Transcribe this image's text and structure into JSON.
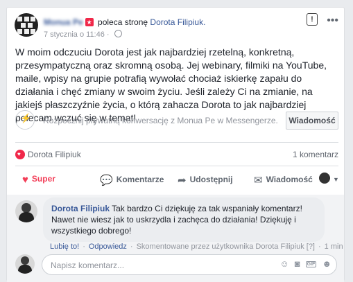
{
  "post": {
    "author": "Monua Pe",
    "recommends_text": "poleca stronę",
    "page_name": "Dorota Filipiuk.",
    "date": "7 stycznia o 11:46",
    "dot": "·",
    "body": "W moim odczuciu Dorota jest jak najbardziej rzetelną, konkretną, przesympatyczną oraz skromną osobą. Jej webinary, filmiki na YouTube, maile, wpisy na grupie potrafią wywołać chociaż iskierkę zapału do działania i chęć zmiany w swoim życiu. Jeśli zależy Ci na zmianie, na jakiejś płaszczyźnie życia, o którą zahacza Dorota to jak najbardziej polecam wczuć się w temat!",
    "icons": [
      "alert-icon",
      "more-dots-icon",
      "globe-icon"
    ]
  },
  "messenger": {
    "prompt": "Rozpocznij prywatną konwersację z Monua Pe w Messengerze.",
    "button": "Wiadomość"
  },
  "reactions": {
    "name": "Dorota Filipiuk",
    "comment_count": "1 komentarz"
  },
  "actions": {
    "super": "Super",
    "comment": "Komentarze",
    "share": "Udostępnij",
    "message": "Wiadomość"
  },
  "comment": {
    "author": "Dorota Filipiuk",
    "text": "Tak bardzo Ci dziękuję za tak wspaniały komentarz! Nawet nie wiesz jak to uskrzydla i zachęca do działania! Dziękuję i wszystkiego dobrego!",
    "like": "Lubię to!",
    "reply": "Odpowiedz",
    "commented_by": "Skomentowane przez użytkownika Dorota Filipiuk [?]",
    "time": "1 min"
  },
  "composer": {
    "placeholder": "Napisz komentarz..."
  },
  "colors": {
    "link": "#385898",
    "super": "#f33e58",
    "background": "#e9ebee"
  }
}
